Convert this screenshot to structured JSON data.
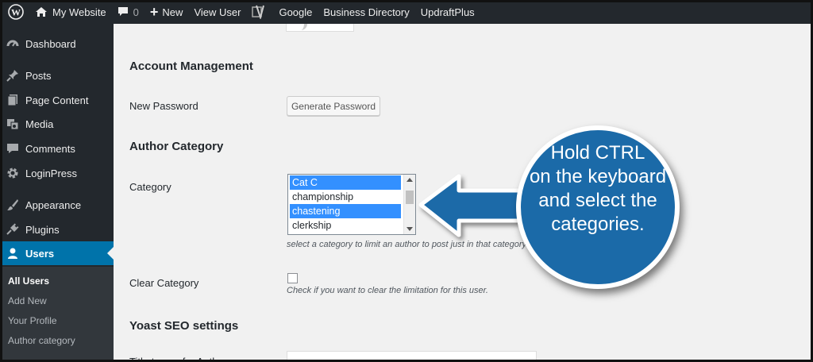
{
  "admin_bar": {
    "site_name": "My Website",
    "comments_count": "0",
    "new_label": "New",
    "view_user_label": "View User",
    "links": [
      "Google",
      "Business Directory",
      "UpdraftPlus"
    ]
  },
  "sidebar": {
    "items": [
      {
        "label": "Dashboard",
        "icon": "dashboard-icon"
      },
      {
        "label": "Posts",
        "icon": "pin-icon"
      },
      {
        "label": "Page Content",
        "icon": "page-icon"
      },
      {
        "label": "Media",
        "icon": "media-icon"
      },
      {
        "label": "Comments",
        "icon": "comment-icon"
      },
      {
        "label": "LoginPress",
        "icon": "gear-icon"
      },
      {
        "label": "Appearance",
        "icon": "brush-icon"
      },
      {
        "label": "Plugins",
        "icon": "plug-icon"
      },
      {
        "label": "Users",
        "icon": "user-icon",
        "active": true
      }
    ],
    "submenu": [
      "All Users",
      "Add New",
      "Your Profile",
      "Author category"
    ]
  },
  "main": {
    "account_heading": "Account Management",
    "new_password_label": "New Password",
    "generate_password_button": "Generate Password",
    "author_category_heading": "Author Category",
    "category_label": "Category",
    "category_options": [
      {
        "label": "Cat C",
        "selected": true
      },
      {
        "label": "championship",
        "selected": false
      },
      {
        "label": "chastening",
        "selected": true
      },
      {
        "label": "clerkship",
        "selected": false
      }
    ],
    "category_description": "select a category to limit an author to post just in that category.",
    "clear_category_label": "Clear Category",
    "clear_category_description": "Check if you want to clear the limitation for this user.",
    "yoast_heading": "Yoast SEO settings",
    "title_label": "Title to use for Author page"
  },
  "callout": {
    "lines": [
      "Hold CTRL",
      "on the keyboard",
      "and select the",
      "categories."
    ],
    "color": "#1b6aa8"
  }
}
